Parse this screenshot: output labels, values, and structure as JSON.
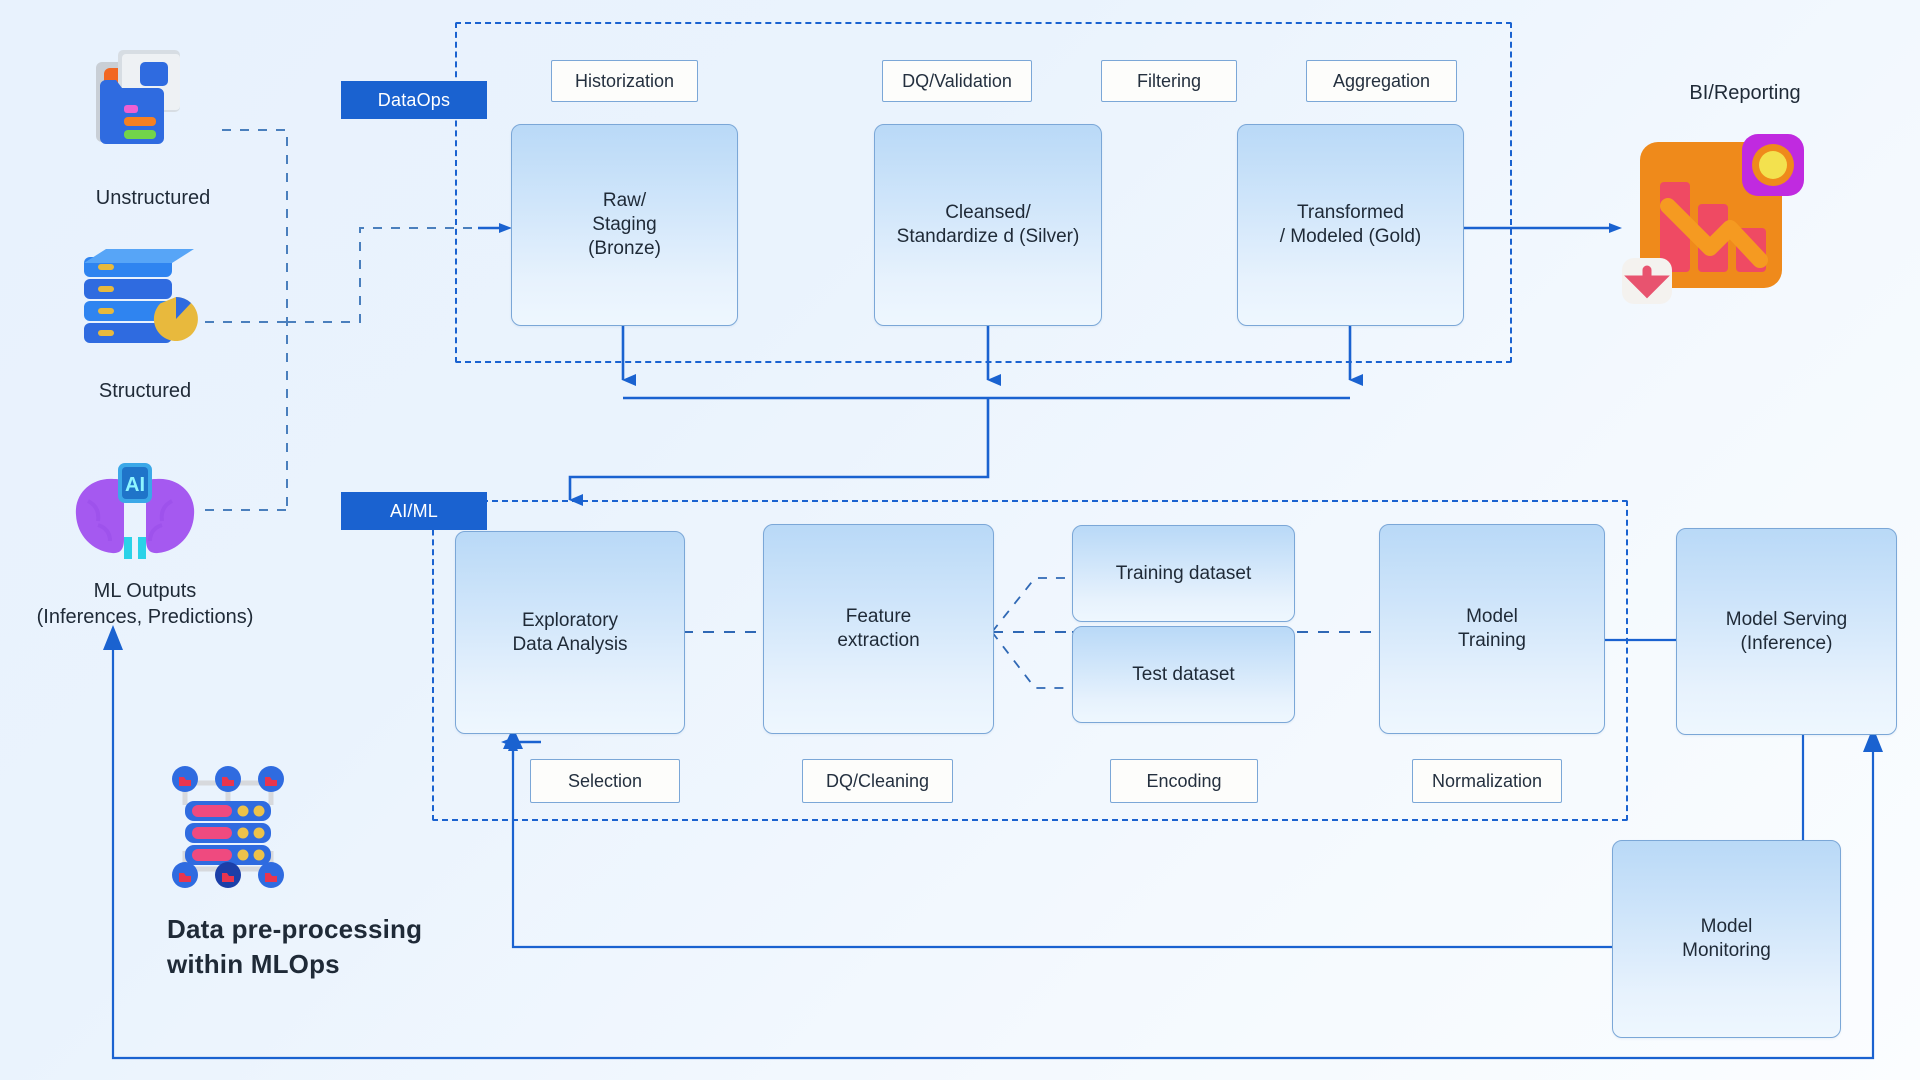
{
  "sources": [
    {
      "id": "unstructured",
      "label": "Unstructured",
      "icon": "folder-documents-icon"
    },
    {
      "id": "structured",
      "label": "Structured",
      "icon": "database-pie-chart-icon"
    },
    {
      "id": "ml-outputs",
      "label": "ML Outputs\n(Inferences, Predictions)",
      "label_line1": "ML Outputs",
      "label_line2": "(Inferences, Predictions)",
      "icon": "ai-brain-chip-icon"
    }
  ],
  "layers": [
    {
      "id": "dataops",
      "chip_label": "DataOps"
    },
    {
      "id": "aiml",
      "chip_label": "AI/ML"
    }
  ],
  "dataops": {
    "tags": [
      {
        "id": "historization",
        "label": "Historization"
      },
      {
        "id": "dq-validation",
        "label": "DQ/Validation"
      },
      {
        "id": "filtering",
        "label": "Filtering"
      },
      {
        "id": "aggregation",
        "label": "Aggregation"
      }
    ],
    "stages": [
      {
        "id": "bronze",
        "line1": "Raw/",
        "line2": "Staging",
        "line3": "(Bronze)"
      },
      {
        "id": "silver",
        "line1": "Cleansed/",
        "line2": "Standardize d (Silver)",
        "line3": ""
      },
      {
        "id": "gold",
        "line1": "Transformed",
        "line2": "/ Modeled (Gold)",
        "line3": ""
      }
    ]
  },
  "aiml": {
    "tags": [
      {
        "id": "selection",
        "label": "Selection"
      },
      {
        "id": "dq-cleaning",
        "label": "DQ/Cleaning"
      },
      {
        "id": "encoding",
        "label": "Encoding"
      },
      {
        "id": "normalization",
        "label": "Normalization"
      }
    ],
    "stages": [
      {
        "id": "eda",
        "line1": "Exploratory",
        "line2": "Data Analysis"
      },
      {
        "id": "feature-extraction",
        "line1": "Feature",
        "line2": "extraction"
      },
      {
        "id": "training-dataset",
        "line1": "Training dataset",
        "line2": ""
      },
      {
        "id": "test-dataset",
        "line1": "Test dataset",
        "line2": ""
      },
      {
        "id": "model-training",
        "line1": "Model",
        "line2": "Training"
      }
    ]
  },
  "serving": {
    "id": "model-serving",
    "line1": "Model Serving",
    "line2": "(Inference)"
  },
  "monitoring": {
    "id": "model-monitoring",
    "line1": "Model",
    "line2": "Monitoring"
  },
  "bi": {
    "label": "BI/Reporting",
    "icon": "bi-report-chart-icon"
  },
  "mlops": {
    "line1": "Data pre-processing",
    "line2": "within MLOps",
    "icon": "distributed-data-nodes-icon"
  },
  "colors": {
    "accent": "#1a62d0",
    "node_border": "#7ba7d7",
    "node_fill_top": "#b9d9f7",
    "node_fill_bottom": "#eef7fe",
    "chip_bg": "#1a62d0",
    "chip_text": "#ffffff",
    "tag_bg": "#fdfdfb",
    "text": "#1f2a37",
    "source_dash": "#4a7fbd",
    "background": "#eaf3fd"
  }
}
